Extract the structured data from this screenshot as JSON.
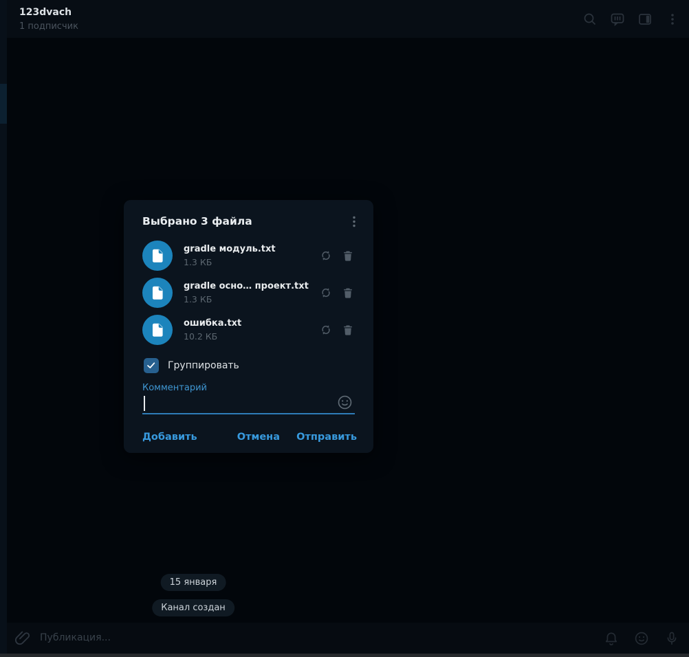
{
  "header": {
    "title": "123dvach",
    "subtitle": "1 подписчик",
    "icons": [
      "search-icon",
      "comments-icon",
      "sidebar-toggle-icon",
      "menu-kebab-icon"
    ]
  },
  "dialog": {
    "title": "Выбрано 3 файла",
    "menu_icon": "menu-kebab-icon",
    "files": [
      {
        "name": "gradle модуль.txt",
        "size": "1.3 КБ",
        "icon": "document-icon",
        "actions": [
          "replace-file-icon",
          "delete-file-icon"
        ]
      },
      {
        "name": "gradle осно… проект.txt",
        "size": "1.3 КБ",
        "icon": "document-icon",
        "actions": [
          "replace-file-icon",
          "delete-file-icon"
        ]
      },
      {
        "name": "ошибка.txt",
        "size": "10.2 КБ",
        "icon": "document-icon",
        "actions": [
          "replace-file-icon",
          "delete-file-icon"
        ]
      }
    ],
    "group": {
      "label": "Группировать",
      "checked": true
    },
    "comment": {
      "label": "Комментарий",
      "value": "",
      "emoji_icon": "smiley-icon"
    },
    "buttons": {
      "add": "Добавить",
      "cancel": "Отмена",
      "send": "Отправить"
    }
  },
  "chat": {
    "date_badge": "15 января",
    "service_badge": "Канал создан"
  },
  "composer": {
    "placeholder": "Публикация...",
    "icons": [
      "paperclip-icon",
      "bell-icon",
      "smiley-icon",
      "microphone-icon"
    ]
  },
  "colors": {
    "page_bg": "#02060b",
    "header_bg": "#070d14",
    "dialog_bg": "#0b141e",
    "accent_blue": "#389ade",
    "file_icon_blue": "#1c84bc",
    "checkbox_blue": "#27608f",
    "underline_blue": "#2e7cb8",
    "muted_text": "#5c6770"
  }
}
